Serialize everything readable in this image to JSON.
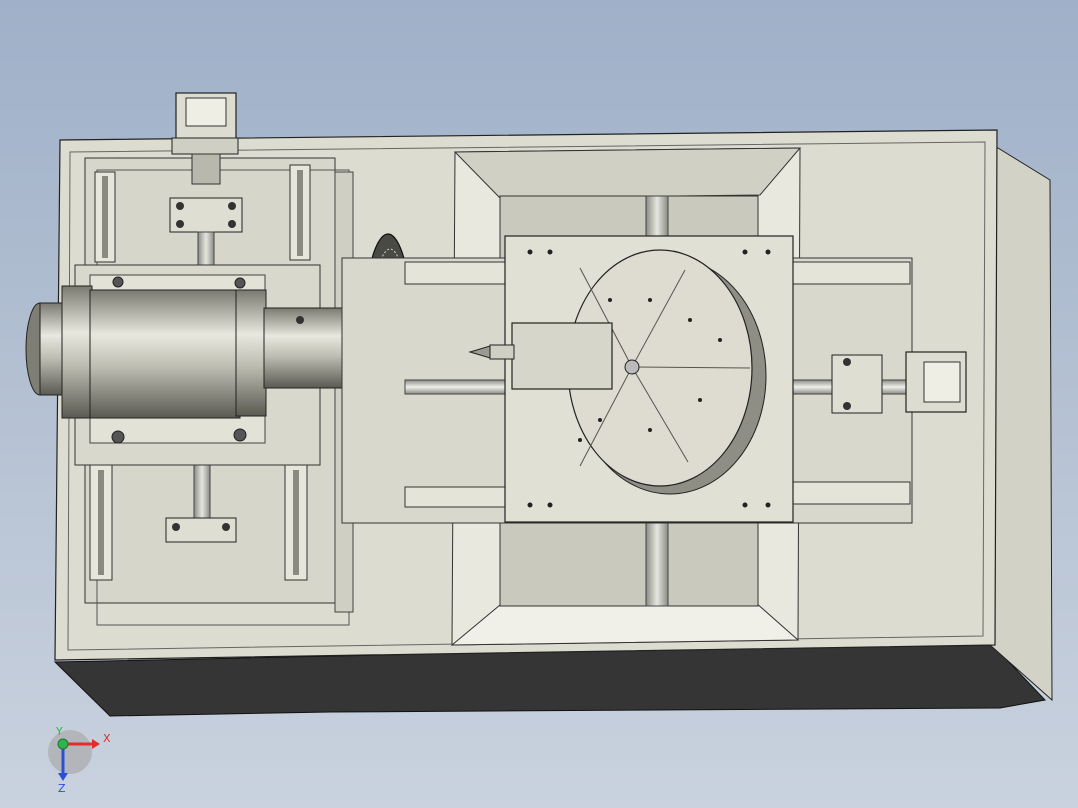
{
  "viewport": {
    "background_top": "#9fb0c8",
    "background_bottom": "#c9d2de",
    "model_color": "#dcdcd0",
    "shadow_color": "#3b3b3b"
  },
  "triad": {
    "x_label": "X",
    "y_label": "Y",
    "z_label": "Z",
    "x_color": "#e52b2b",
    "y_color": "#2fb34a",
    "z_color": "#2b4fd6"
  },
  "icons": {
    "triad": "axis-triad-icon"
  }
}
